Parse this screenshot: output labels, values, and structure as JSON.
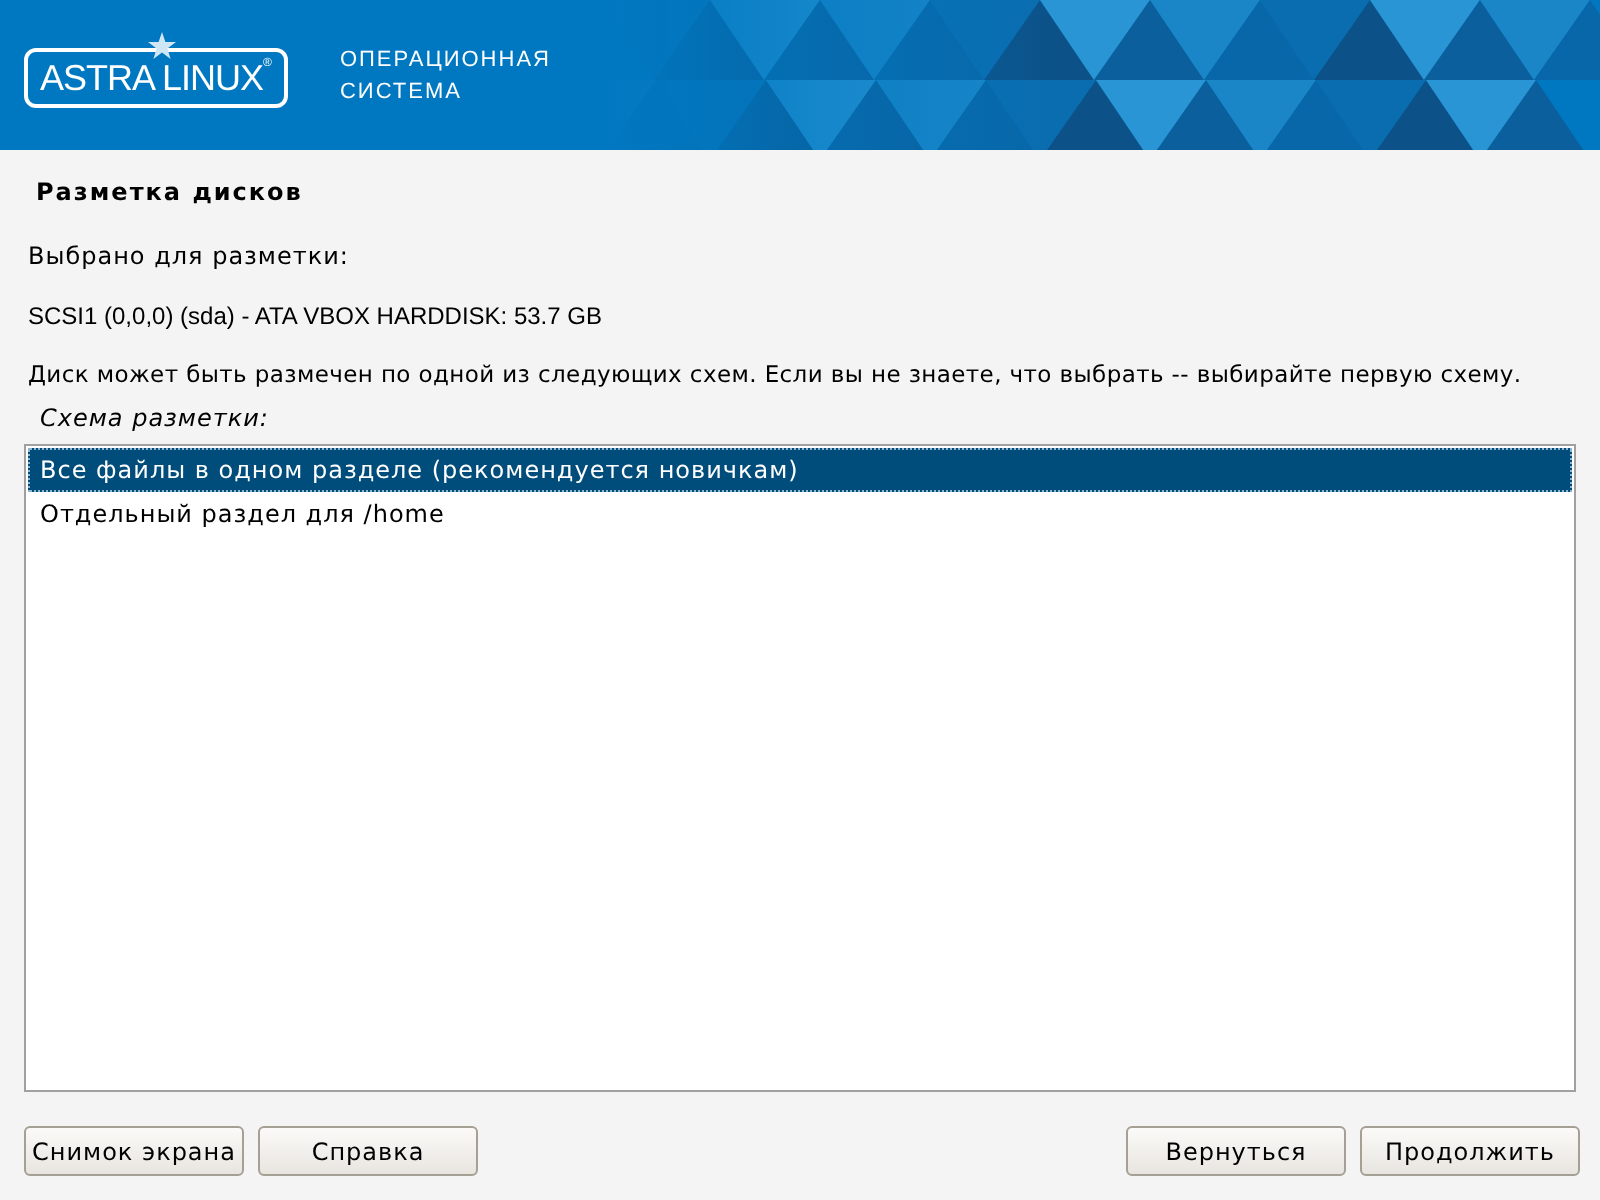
{
  "header": {
    "logo": {
      "text": "ASTRA LINUX",
      "mark": "®"
    },
    "subtitle": [
      "ОПЕРАЦИОННАЯ",
      "СИСТЕМА"
    ]
  },
  "title": "Разметка дисков",
  "selected_label": "Выбрано для разметки:",
  "disk": "SCSI1 (0,0,0) (sda) - ATA VBOX HARDDISK: 53.7 GB",
  "description": "Диск может быть размечен по одной из следующих схем. Если вы не знаете, что выбрать -- выбирайте первую схему.",
  "list_label": "Схема разметки:",
  "options": [
    {
      "label": "Все файлы в одном разделе (рекомендуется новичкам)",
      "selected": true
    },
    {
      "label": "Отдельный раздел для /home",
      "selected": false
    }
  ],
  "buttons_left": [
    "Снимок экрана",
    "Справка"
  ],
  "buttons_right": [
    "Вернуться",
    "Продолжить"
  ]
}
